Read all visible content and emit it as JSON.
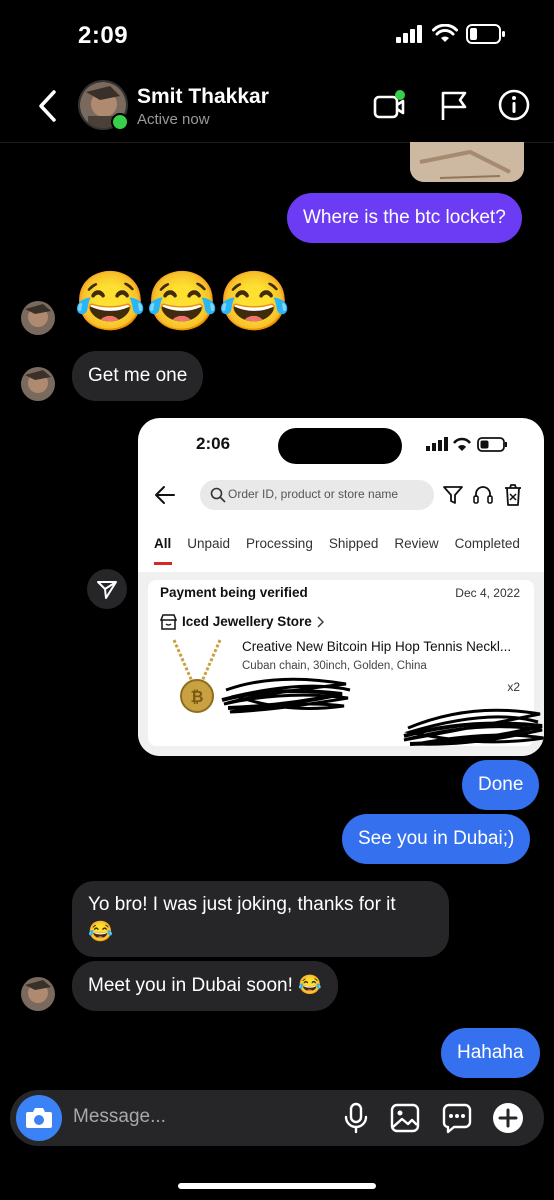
{
  "status_bar": {
    "time": "2:09"
  },
  "header": {
    "name": "Smit Thakkar",
    "status": "Active now"
  },
  "messages": {
    "m1": "Where is the btc locket?",
    "m2_emojis": "😂😂😂",
    "m3": "Get me one",
    "m5": "Done",
    "m6": "See you in Dubai;)",
    "m7_line1": "Yo bro! I was just joking, thanks for it",
    "m7_line2": "😂",
    "m8": "Meet you in Dubai soon! 😂",
    "m9": "Hahaha"
  },
  "shared_screenshot": {
    "time": "2:06",
    "search_placeholder": "Order ID, product or store name",
    "tabs": [
      "All",
      "Unpaid",
      "Processing",
      "Shipped",
      "Review",
      "Completed"
    ],
    "order_status": "Payment being verified",
    "order_date": "Dec 4, 2022",
    "store": "Iced Jewellery Store",
    "product": "Creative New Bitcoin Hip Hop Tennis Neckl...",
    "variant": "Cuban chain, 30inch, Golden, China",
    "quantity": "x2"
  },
  "composer": {
    "placeholder": "Message..."
  },
  "colors": {
    "sent_purple": "#6c3cf5",
    "sent_blue": "#3570ee",
    "received": "#262628",
    "online": "#37d04a"
  }
}
